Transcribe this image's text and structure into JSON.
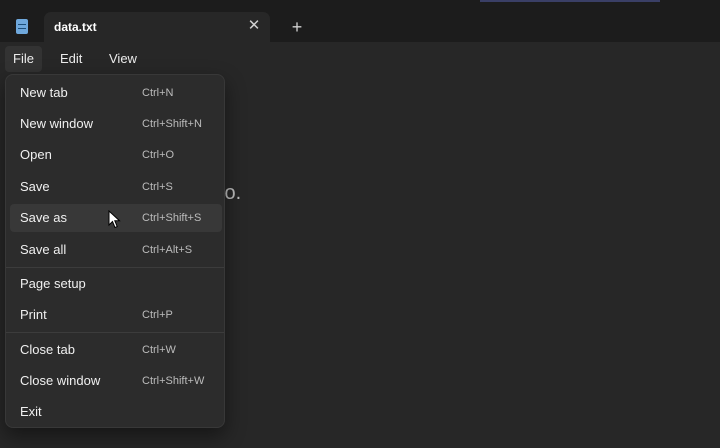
{
  "tab": {
    "title": "data.txt",
    "close_glyph": "✕",
    "new_glyph": "+"
  },
  "menubar": {
    "file": "File",
    "edit": "Edit",
    "view": "View"
  },
  "editor": {
    "visible_text": "lo."
  },
  "file_menu": {
    "items": [
      {
        "label": "New tab",
        "shortcut": "Ctrl+N"
      },
      {
        "label": "New window",
        "shortcut": "Ctrl+Shift+N"
      },
      {
        "label": "Open",
        "shortcut": "Ctrl+O"
      },
      {
        "label": "Save",
        "shortcut": "Ctrl+S"
      },
      {
        "label": "Save as",
        "shortcut": "Ctrl+Shift+S"
      },
      {
        "label": "Save all",
        "shortcut": "Ctrl+Alt+S"
      },
      {
        "label": "Page setup",
        "shortcut": ""
      },
      {
        "label": "Print",
        "shortcut": "Ctrl+P"
      },
      {
        "label": "Close tab",
        "shortcut": "Ctrl+W"
      },
      {
        "label": "Close window",
        "shortcut": "Ctrl+Shift+W"
      },
      {
        "label": "Exit",
        "shortcut": ""
      }
    ]
  },
  "colors": {
    "background": "#272727",
    "menu": "#2c2c2c",
    "hover": "#383838",
    "titlebar": "#1c1c1c"
  },
  "icons": {
    "app": "notepad-icon",
    "cursor": "mouse-pointer-icon"
  }
}
